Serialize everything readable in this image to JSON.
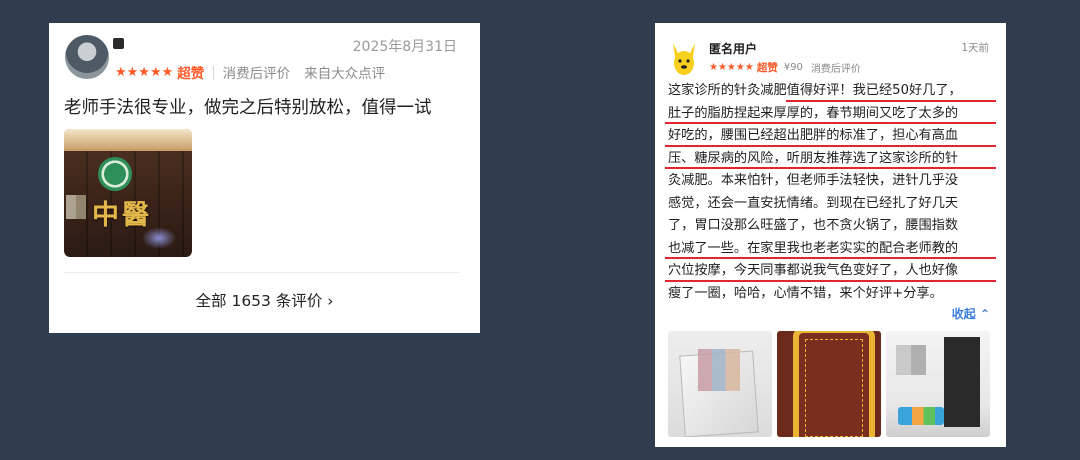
{
  "left_review": {
    "date": "2025年8月31日",
    "stars": "★★★★★",
    "rating_label": "超赞",
    "meta_type": "消费后评价",
    "meta_source": "来自大众点评",
    "text": "老师手法很专业，做完之后特别放松，值得一试",
    "photo_sign_text": "中醫",
    "all_reviews_label": "全部 1653 条评价 ›"
  },
  "right_review": {
    "username": "匿名用户",
    "time": "1天前",
    "stars": "★★★★★",
    "rating_label": "超赞",
    "price": "¥90",
    "meta_type": "消费后评价",
    "lines": [
      "这家诊所的针灸减肥值得好评！我已经50好几了，",
      "肚子的脂肪捏起来厚厚的，春节期间又吃了太多的",
      "好吃的，腰围已经超出肥胖的标准了，担心有高血",
      "压、糖尿病的风险，听朋友推荐选了这家诊所的针",
      "灸减肥。本来怕针，但老师手法轻快，进针几乎没",
      "感觉，还会一直安抚情绪。到现在已经扎了好几天",
      "了，胃口没那么旺盛了，也不贪火锅了，腰围指数",
      "也减了一些。在家里我也老老实实的配合老师教的",
      "穴位按摩，今天同事都说我气色变好了，人也好像",
      "瘦了一圈，哈哈，心情不错，来个好评+分享。"
    ],
    "collapse_label": "收起 ⌃",
    "highlight_color": "#e3252f"
  },
  "colors": {
    "background": "#2f3d4e",
    "accent_orange": "#ff5a2a",
    "link_blue": "#3b7ddb"
  }
}
